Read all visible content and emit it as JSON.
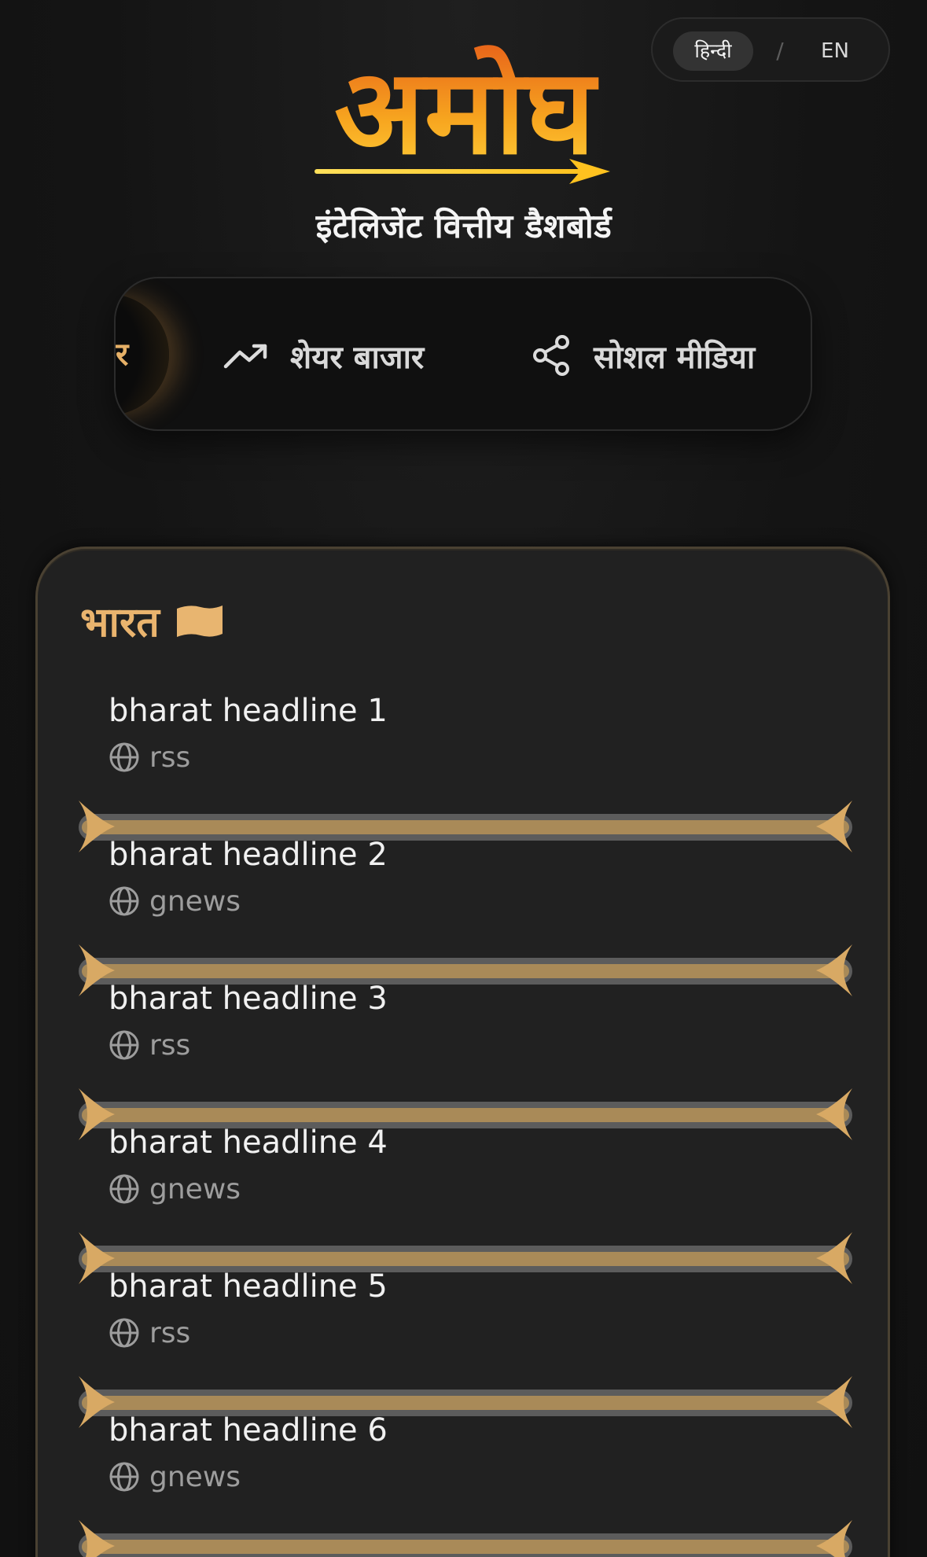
{
  "brand": {
    "logo_text": "अमोघ",
    "subtitle": "इंटेलिजेंट वित्तीय डैशबोर्ड"
  },
  "language_switch": {
    "hindi": "हिन्दी",
    "separator": "/",
    "english": "EN",
    "selected": "hindi"
  },
  "nav": {
    "active_partial_label": "र",
    "items": [
      {
        "label": "शेयर बाजार",
        "icon": "trending-up-icon"
      },
      {
        "label": "सोशल मीडिया",
        "icon": "share-icon"
      }
    ]
  },
  "section": {
    "title": "भारत",
    "flag_icon": "flag-icon",
    "news": [
      {
        "title": "bharat headline 1",
        "source": "rss"
      },
      {
        "title": "bharat headline 2",
        "source": "gnews"
      },
      {
        "title": "bharat headline 3",
        "source": "rss"
      },
      {
        "title": "bharat headline 4",
        "source": "gnews"
      },
      {
        "title": "bharat headline 5",
        "source": "rss"
      },
      {
        "title": "bharat headline 6",
        "source": "gnews"
      }
    ]
  },
  "colors": {
    "accent": "#eab46e",
    "background": "#141414",
    "card": "#212121",
    "logo_gradient_top": "#e8651a",
    "logo_gradient_bottom": "#ffd23a"
  }
}
